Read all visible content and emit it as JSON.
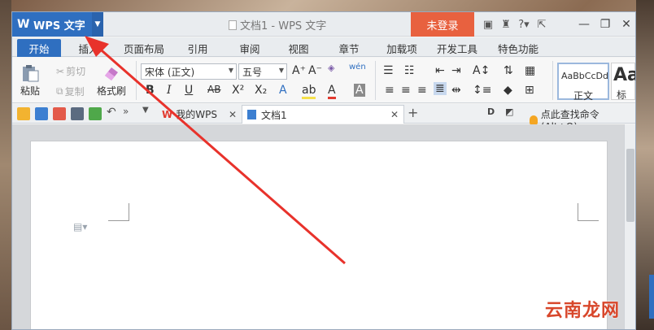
{
  "app": {
    "name": "WPS 文字",
    "logo": "W"
  },
  "window": {
    "title": "文档1 - WPS 文字",
    "login": "未登录"
  },
  "title_icons": [
    "skin-icon",
    "tshirt-icon",
    "help-icon",
    "fullscreen-icon"
  ],
  "tabs": [
    "开始",
    "插入",
    "页面布局",
    "引用",
    "审阅",
    "视图",
    "章节",
    "加载项",
    "开发工具",
    "特色功能"
  ],
  "ribbon": {
    "paste": "粘贴",
    "cut": "剪切",
    "copy": "复制",
    "format_painter": "格式刷",
    "font_name": "宋体 (正文)",
    "font_size": "五号",
    "style_normal_preview": "AaBbCcDd",
    "style_normal": "正文",
    "style_heading_preview": "Aa",
    "style_heading": "标"
  },
  "doc_tabs": {
    "my_wps": "我的WPS",
    "doc1": "文档1"
  },
  "search_command": "点此查找命令 (Alt+Q)",
  "watermark": "云南龙网",
  "colors": {
    "accent": "#2f6fc0",
    "login": "#e8613f",
    "arrow": "#e8322b"
  }
}
